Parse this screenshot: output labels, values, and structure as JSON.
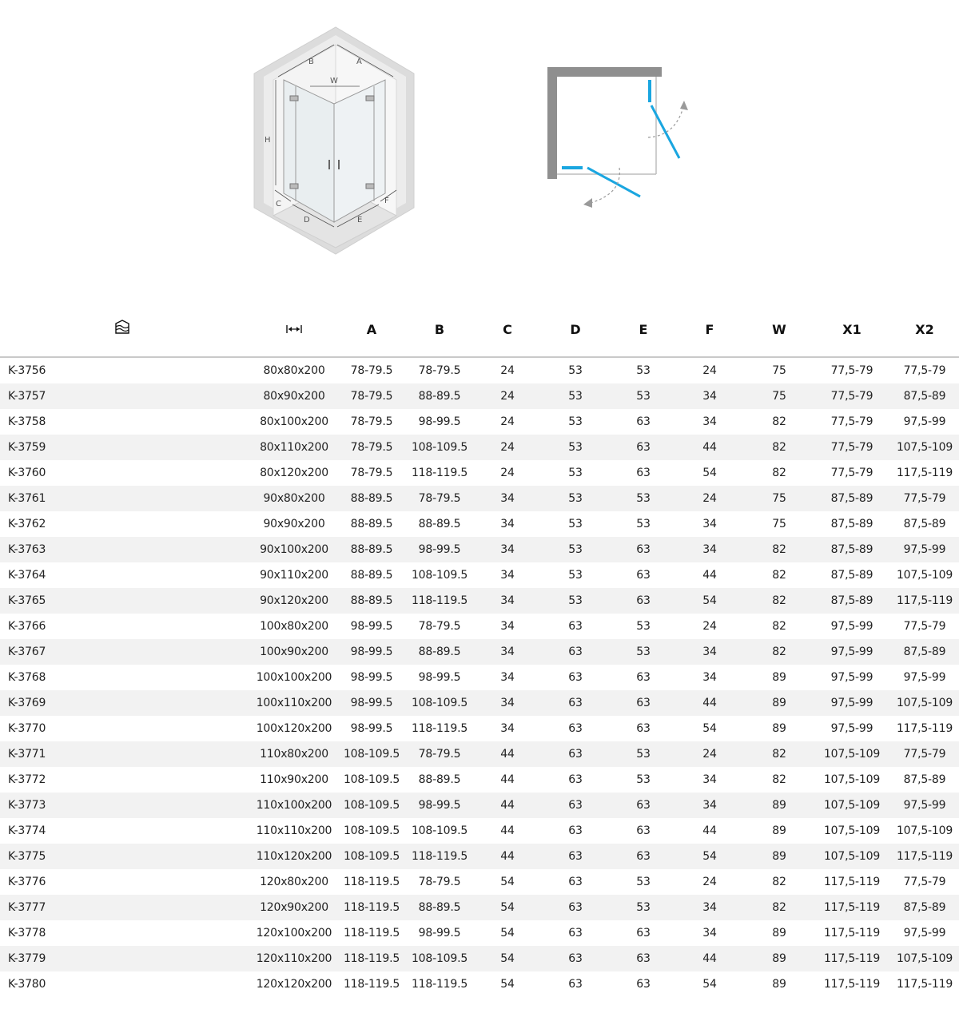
{
  "diagram": {
    "iso_labels": {
      "a": "A",
      "b": "B",
      "w": "W",
      "h": "H",
      "c": "C",
      "d": "D",
      "e": "E",
      "f": "F"
    },
    "accent_color": "#1aa6e0"
  },
  "table": {
    "header_icons": [
      "shower-tray-icon",
      "width-arrows-icon"
    ],
    "columns": [
      "A",
      "B",
      "C",
      "D",
      "E",
      "F",
      "W",
      "X1",
      "X2"
    ],
    "rows": [
      [
        "K-3756",
        "80x80x200",
        "78-79.5",
        "78-79.5",
        "24",
        "53",
        "53",
        "24",
        "75",
        "77,5-79",
        "77,5-79"
      ],
      [
        "K-3757",
        "80x90x200",
        "78-79.5",
        "88-89.5",
        "24",
        "53",
        "53",
        "34",
        "75",
        "77,5-79",
        "87,5-89"
      ],
      [
        "K-3758",
        "80x100x200",
        "78-79.5",
        "98-99.5",
        "24",
        "53",
        "63",
        "34",
        "82",
        "77,5-79",
        "97,5-99"
      ],
      [
        "K-3759",
        "80x110x200",
        "78-79.5",
        "108-109.5",
        "24",
        "53",
        "63",
        "44",
        "82",
        "77,5-79",
        "107,5-109"
      ],
      [
        "K-3760",
        "80x120x200",
        "78-79.5",
        "118-119.5",
        "24",
        "53",
        "63",
        "54",
        "82",
        "77,5-79",
        "117,5-119"
      ],
      [
        "K-3761",
        "90x80x200",
        "88-89.5",
        "78-79.5",
        "34",
        "53",
        "53",
        "24",
        "75",
        "87,5-89",
        "77,5-79"
      ],
      [
        "K-3762",
        "90x90x200",
        "88-89.5",
        "88-89.5",
        "34",
        "53",
        "53",
        "34",
        "75",
        "87,5-89",
        "87,5-89"
      ],
      [
        "K-3763",
        "90x100x200",
        "88-89.5",
        "98-99.5",
        "34",
        "53",
        "63",
        "34",
        "82",
        "87,5-89",
        "97,5-99"
      ],
      [
        "K-3764",
        "90x110x200",
        "88-89.5",
        "108-109.5",
        "34",
        "53",
        "63",
        "44",
        "82",
        "87,5-89",
        "107,5-109"
      ],
      [
        "K-3765",
        "90x120x200",
        "88-89.5",
        "118-119.5",
        "34",
        "53",
        "63",
        "54",
        "82",
        "87,5-89",
        "117,5-119"
      ],
      [
        "K-3766",
        "100x80x200",
        "98-99.5",
        "78-79.5",
        "34",
        "63",
        "53",
        "24",
        "82",
        "97,5-99",
        "77,5-79"
      ],
      [
        "K-3767",
        "100x90x200",
        "98-99.5",
        "88-89.5",
        "34",
        "63",
        "53",
        "34",
        "82",
        "97,5-99",
        "87,5-89"
      ],
      [
        "K-3768",
        "100x100x200",
        "98-99.5",
        "98-99.5",
        "34",
        "63",
        "63",
        "34",
        "89",
        "97,5-99",
        "97,5-99"
      ],
      [
        "K-3769",
        "100x110x200",
        "98-99.5",
        "108-109.5",
        "34",
        "63",
        "63",
        "44",
        "89",
        "97,5-99",
        "107,5-109"
      ],
      [
        "K-3770",
        "100x120x200",
        "98-99.5",
        "118-119.5",
        "34",
        "63",
        "63",
        "54",
        "89",
        "97,5-99",
        "117,5-119"
      ],
      [
        "K-3771",
        "110x80x200",
        "108-109.5",
        "78-79.5",
        "44",
        "63",
        "53",
        "24",
        "82",
        "107,5-109",
        "77,5-79"
      ],
      [
        "K-3772",
        "110x90x200",
        "108-109.5",
        "88-89.5",
        "44",
        "63",
        "53",
        "34",
        "82",
        "107,5-109",
        "87,5-89"
      ],
      [
        "K-3773",
        "110x100x200",
        "108-109.5",
        "98-99.5",
        "44",
        "63",
        "63",
        "34",
        "89",
        "107,5-109",
        "97,5-99"
      ],
      [
        "K-3774",
        "110x110x200",
        "108-109.5",
        "108-109.5",
        "44",
        "63",
        "63",
        "44",
        "89",
        "107,5-109",
        "107,5-109"
      ],
      [
        "K-3775",
        "110x120x200",
        "108-109.5",
        "118-119.5",
        "44",
        "63",
        "63",
        "54",
        "89",
        "107,5-109",
        "117,5-119"
      ],
      [
        "K-3776",
        "120x80x200",
        "118-119.5",
        "78-79.5",
        "54",
        "63",
        "53",
        "24",
        "82",
        "117,5-119",
        "77,5-79"
      ],
      [
        "K-3777",
        "120x90x200",
        "118-119.5",
        "88-89.5",
        "54",
        "63",
        "53",
        "34",
        "82",
        "117,5-119",
        "87,5-89"
      ],
      [
        "K-3778",
        "120x100x200",
        "118-119.5",
        "98-99.5",
        "54",
        "63",
        "63",
        "34",
        "89",
        "117,5-119",
        "97,5-99"
      ],
      [
        "K-3779",
        "120x110x200",
        "118-119.5",
        "108-109.5",
        "54",
        "63",
        "63",
        "44",
        "89",
        "117,5-119",
        "107,5-109"
      ],
      [
        "K-3780",
        "120x120x200",
        "118-119.5",
        "118-119.5",
        "54",
        "63",
        "63",
        "54",
        "89",
        "117,5-119",
        "117,5-119"
      ]
    ]
  }
}
